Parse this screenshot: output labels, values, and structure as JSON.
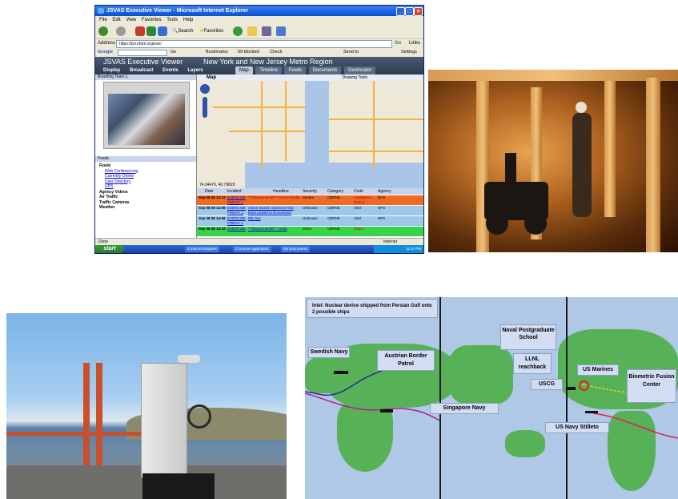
{
  "ie": {
    "title": "JSVAS Executive Viewer - Microsoft Internet Explorer",
    "menu": [
      "File",
      "Edit",
      "View",
      "Favorites",
      "Tools",
      "Help"
    ],
    "toolbar": {
      "search": "Search",
      "favorites": "Favorites"
    },
    "address_label": "Address",
    "address_url": "https://jsv.nfam.org/exe/",
    "go": "Go",
    "links": "Links",
    "google_label": "Google",
    "googlebar": {
      "go": "Go",
      "bookmarks": "Bookmarks",
      "blocked": "59 blocked",
      "check": "Check",
      "sendto": "Send to",
      "settings": "Settings"
    },
    "status": "Done",
    "status_zone": "Internet"
  },
  "viewer": {
    "app_name": "JSVAS Executive Viewer",
    "region": "New York and New Jersey Metro Region",
    "nav": [
      "Display",
      "Broadcast",
      "Events",
      "Layers"
    ],
    "tabs": [
      "Map",
      "Timeline",
      "Feeds",
      "Documents",
      "Geolocator"
    ]
  },
  "left": {
    "pane_title": "Boarding Team 1",
    "feeds_title": "Feeds",
    "tree": {
      "root": "Feeds",
      "links": [
        "Web Conferencing",
        "Currently Online",
        "User Directory",
        "UPS"
      ],
      "groups": [
        "Agency Videos",
        "Air Traffic",
        "Traffic Cameras",
        "Weather"
      ]
    }
  },
  "map": {
    "title": "Map",
    "drawing_tools": "Drawing Tools",
    "coords": "74.04476, 40.79820"
  },
  "grid": {
    "columns": [
      "Date",
      "Incident",
      "Headline",
      "Severity",
      "Category",
      "Code",
      "Agency"
    ],
    "rows": [
      {
        "date": "Sep 08 08 13:13",
        "incident": "EXERCISE FRIDAY 1",
        "headline": "***Experimental*** Phone Model",
        "severity": "Severe",
        "category": "CBRNE",
        "code": "Intelligence Report",
        "agency": "DHS",
        "color": "#f06a23"
      },
      {
        "date": "Sep 08 08 14:58",
        "incident": "EXERCISE FRIDAY 1",
        "headline": "Active Search Spectrum has been posted to Documents",
        "severity": "Unknown",
        "category": "CBRNE",
        "code": "Alert",
        "agency": "NPS",
        "color": "#9ec8ea"
      },
      {
        "date": "Sep 08 08 14:56",
        "incident": "EXERCISE FRIDAY 1",
        "headline": "NB Ops",
        "severity": "Unknown",
        "category": "CBRNE",
        "code": "Alert",
        "agency": "NPS",
        "color": "#9ec8ea"
      },
      {
        "date": "Sep 08 08 14:43",
        "incident": "EXERCISE",
        "headline": "***Experimental*** Delta",
        "severity": "Minor",
        "category": "CBRNE",
        "code": "Status",
        "agency": "",
        "color": "#37d34a"
      }
    ]
  },
  "taskbar": {
    "start": "start",
    "tasks": [
      "4 Internet Explorer",
      "2 Groove Application",
      "My Documents"
    ],
    "clock": "11:27 PM"
  },
  "slide": {
    "intel": "Intel: Nuclear device shipped from Persian Gulf onto 2 possible ships",
    "swedish_navy": "Swedish Navy",
    "austrian_border_patrol": "Austrian Border Patrol",
    "naval_postgraduate_school": "Naval Postgraduate School",
    "llnl_reachback": "LLNL reachback",
    "us_marines": "US Marines",
    "uscg": "USCG",
    "biometric_fusion_center": "Biometric Fusion Center",
    "singapore_navy": "Singapore Navy",
    "us_navy_stilleto": "US Navy Stilleto"
  },
  "colors": {
    "xp_blue": "#0a4fd0",
    "row_severe": "#f06a23",
    "row_unknown": "#9ec8ea",
    "row_minor": "#37d34a",
    "land_green": "#57b157",
    "ocean": "#aec8e6",
    "callout": "#d2dcf2"
  }
}
